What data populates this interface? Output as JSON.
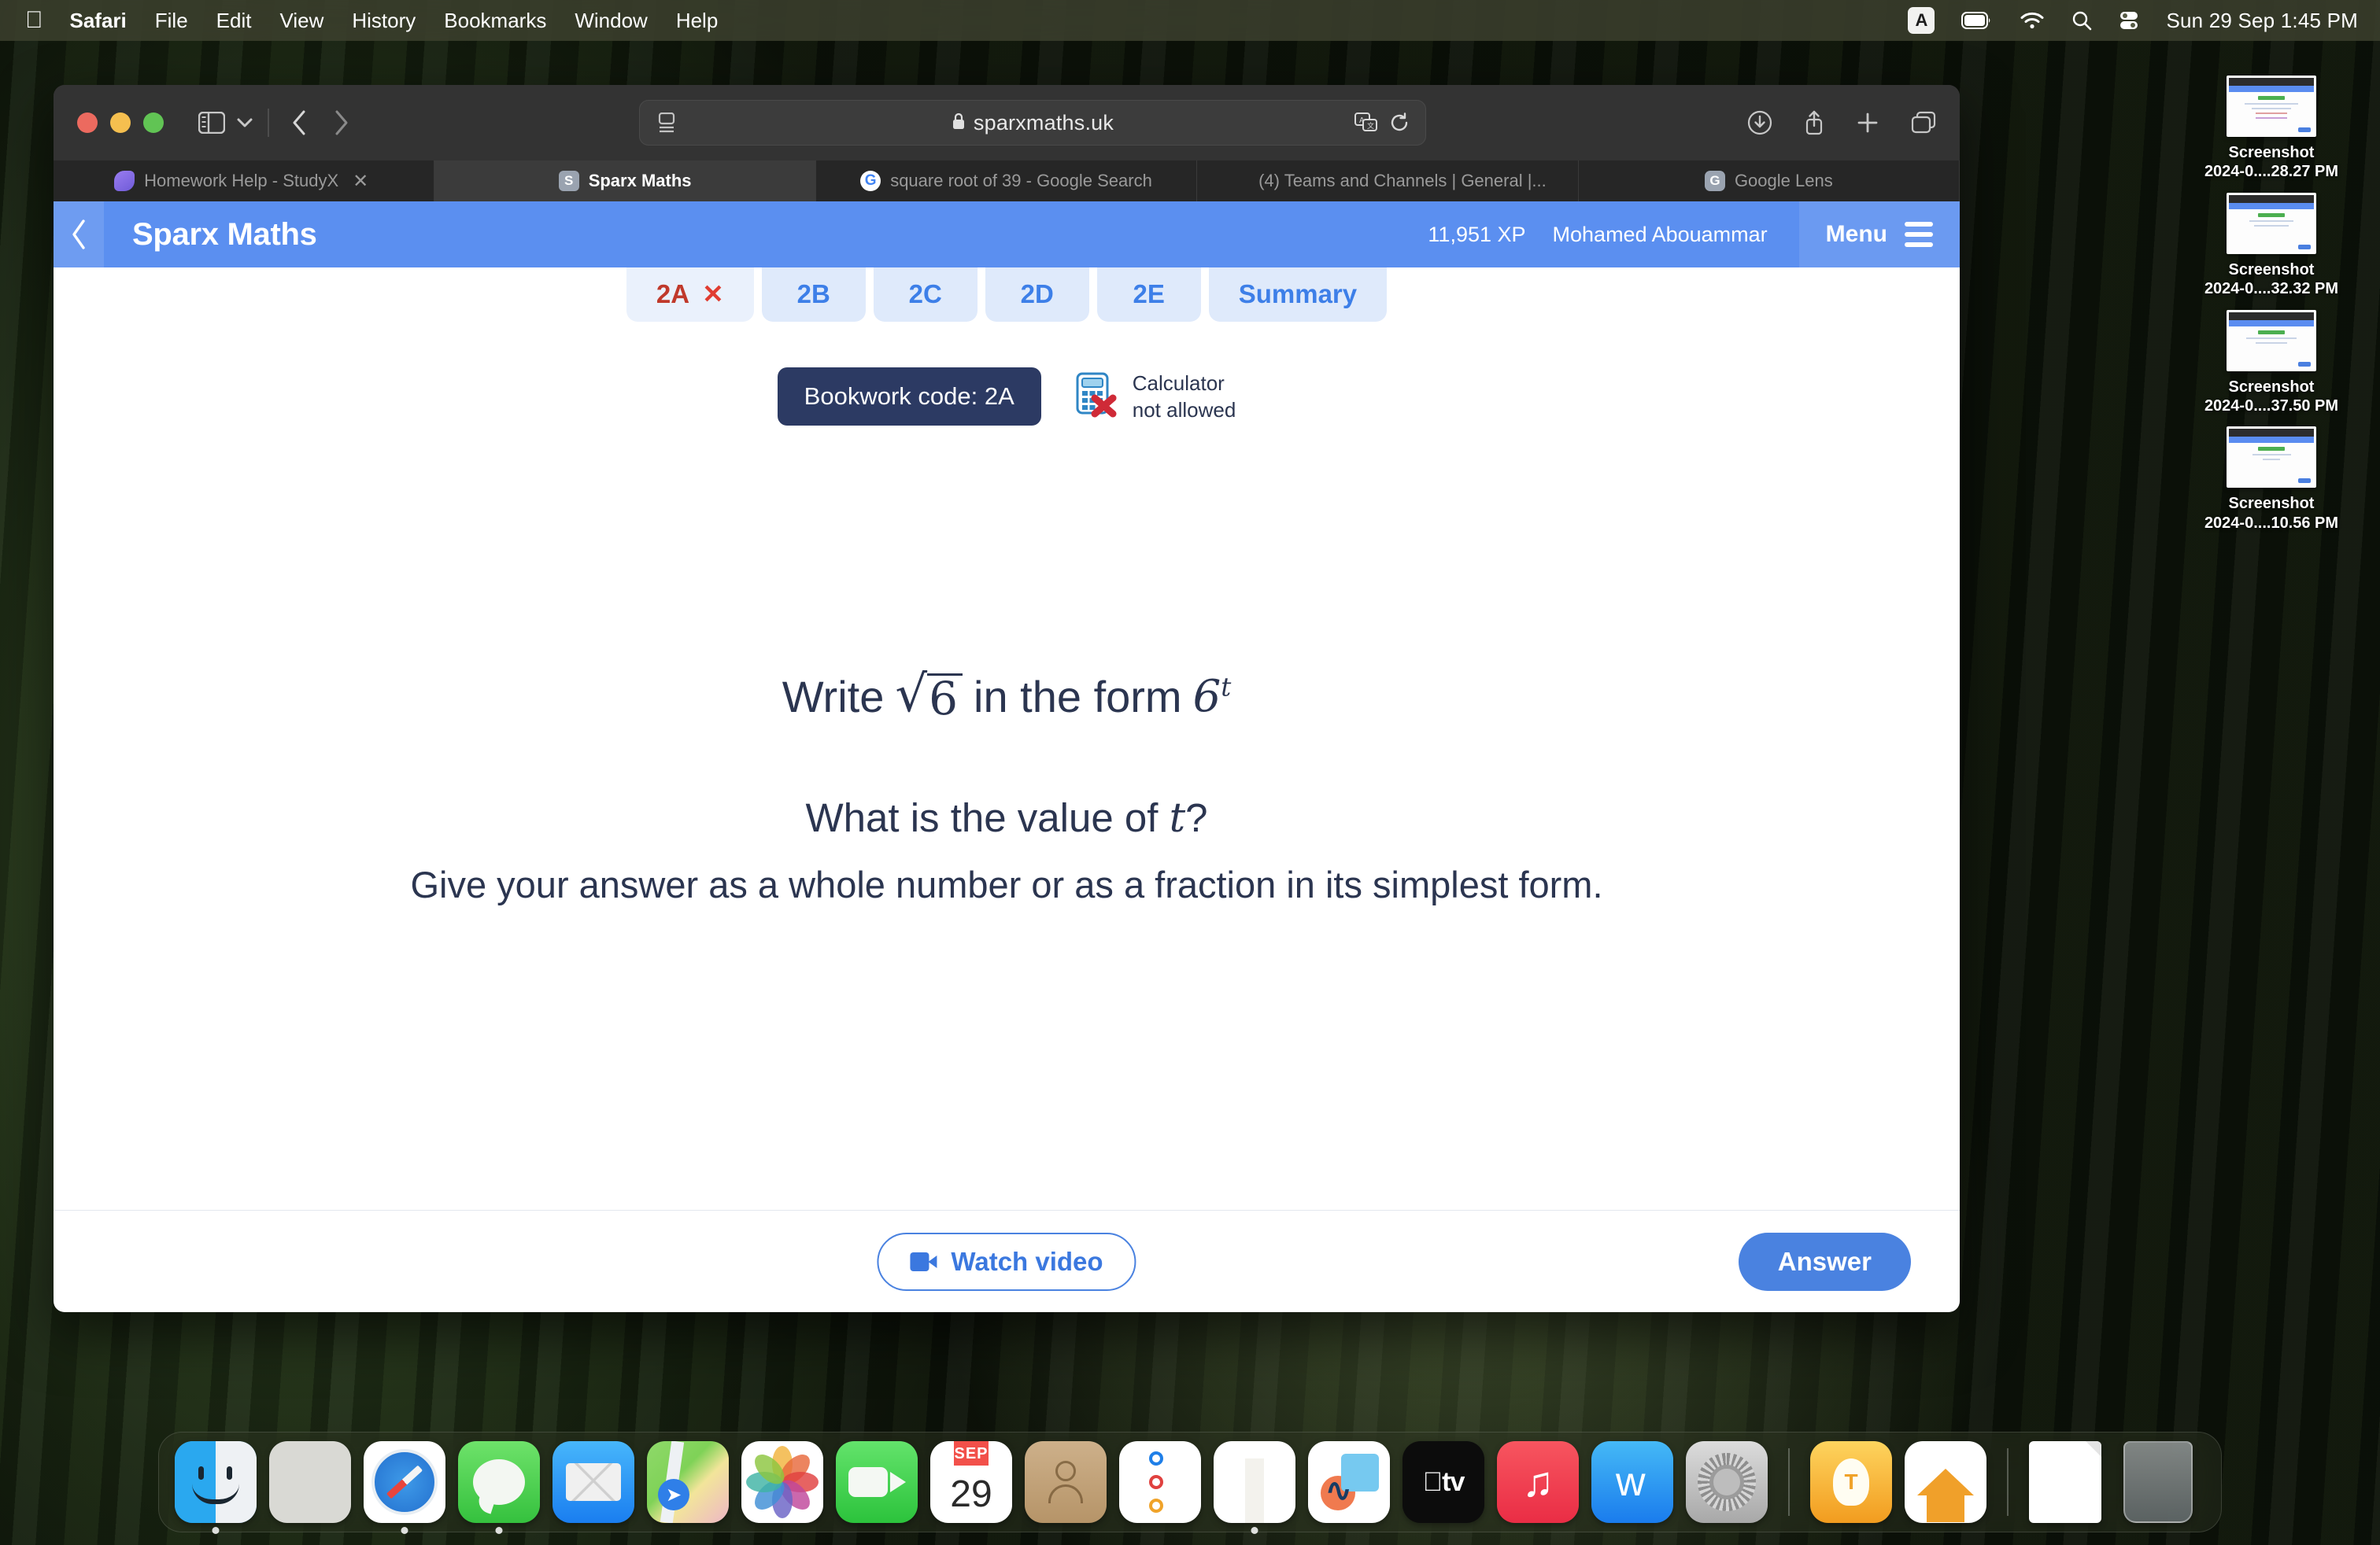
{
  "menubar": {
    "apple_icon": "apple-logo-icon",
    "items": [
      {
        "label": "Safari",
        "bold": true
      },
      {
        "label": "File",
        "bold": false
      },
      {
        "label": "Edit",
        "bold": false
      },
      {
        "label": "View",
        "bold": false
      },
      {
        "label": "History",
        "bold": false
      },
      {
        "label": "Bookmarks",
        "bold": false
      },
      {
        "label": "Window",
        "bold": false
      },
      {
        "label": "Help",
        "bold": false
      }
    ],
    "status": {
      "input_source": "A",
      "battery_icon": "battery-icon",
      "wifi_icon": "wifi-icon",
      "search_icon": "search-icon",
      "control_center_icon": "control-center-icon",
      "clock": "Sun 29 Sep  1:45 PM"
    }
  },
  "desktop_icons": [
    {
      "label_line1": "Screenshot",
      "label_line2": "2024-0....28.27 PM"
    },
    {
      "label_line1": "Screenshot",
      "label_line2": "2024-0....32.32 PM"
    },
    {
      "label_line1": "Screenshot",
      "label_line2": "2024-0....37.50 PM"
    },
    {
      "label_line1": "Screenshot",
      "label_line2": "2024-0....10.56 PM"
    }
  ],
  "browser": {
    "toolbar": {
      "sidebar_icon": "sidebar-toggle-icon",
      "chevron_icon": "chevron-down-icon",
      "back_icon": "back-arrow-icon",
      "forward_icon": "forward-arrow-icon",
      "reader_icon": "reader-view-icon",
      "lock_icon": "lock-icon",
      "url": "sparxmaths.uk",
      "translate_icon": "translate-icon",
      "reload_icon": "reload-icon",
      "downloads_icon": "downloads-icon",
      "share_icon": "share-icon",
      "newtab_icon": "new-tab-icon",
      "tabs_overview_icon": "tab-overview-icon"
    },
    "tabs": [
      {
        "label": "Homework Help - StudyX",
        "favicon": "studyx-icon",
        "active": false,
        "has_close": true
      },
      {
        "label": "Sparx Maths",
        "favicon": "sparx-icon",
        "active": true,
        "has_close": false
      },
      {
        "label": "square root of 39 - Google Search",
        "favicon": "google-icon",
        "active": false,
        "has_close": false
      },
      {
        "label": "(4) Teams and Channels | General |...",
        "favicon": "teams-icon",
        "active": false,
        "has_close": false
      },
      {
        "label": "Google Lens",
        "favicon": "google-lens-icon",
        "active": false,
        "has_close": false
      }
    ]
  },
  "sparx": {
    "header": {
      "back_icon": "back-chevron-icon",
      "title": "Sparx Maths",
      "xp": "11,951 XP",
      "user": "Mohamed Abouammar",
      "menu_label": "Menu",
      "menu_icon": "hamburger-menu-icon",
      "accent_color": "#5b8ff0"
    },
    "question_tabs": [
      {
        "label": "2A",
        "active": true,
        "mark": "✕"
      },
      {
        "label": "2B",
        "active": false,
        "mark": ""
      },
      {
        "label": "2C",
        "active": false,
        "mark": ""
      },
      {
        "label": "2D",
        "active": false,
        "mark": ""
      },
      {
        "label": "2E",
        "active": false,
        "mark": ""
      },
      {
        "label": "Summary",
        "active": false,
        "mark": ""
      }
    ],
    "meta": {
      "bookwork_code": "Bookwork code: 2A",
      "bookwork_bg": "#2c3a63",
      "calculator_icon": "calculator-not-allowed-icon",
      "calculator_line1": "Calculator",
      "calculator_line2": "not allowed"
    },
    "question": {
      "line1_prefix": "Write",
      "radical_symbol": "√",
      "radicand": "6",
      "line1_middle": "in the form",
      "base": "6",
      "exponent": "t",
      "line2": "What is the value of",
      "line2_var": "t",
      "line2_suffix": "?",
      "line3": "Give your answer as a whole number or as a fraction in its simplest form."
    },
    "footer": {
      "watch_video_label": "Watch video",
      "watch_video_icon": "video-camera-icon",
      "answer_label": "Answer",
      "answer_bg": "#4a82e0"
    }
  },
  "dock": {
    "items": [
      {
        "name": "Finder",
        "icon": "finder-icon",
        "running": true
      },
      {
        "name": "Launchpad",
        "icon": "launchpad-icon",
        "running": false
      },
      {
        "name": "Safari",
        "icon": "safari-icon",
        "running": true
      },
      {
        "name": "Messages",
        "icon": "messages-icon",
        "running": true
      },
      {
        "name": "Mail",
        "icon": "mail-icon",
        "running": false
      },
      {
        "name": "Maps",
        "icon": "maps-icon",
        "running": false
      },
      {
        "name": "Photos",
        "icon": "photos-icon",
        "running": false
      },
      {
        "name": "FaceTime",
        "icon": "facetime-icon",
        "running": false
      },
      {
        "name": "Calendar",
        "icon": "calendar-icon",
        "running": false,
        "month": "SEP",
        "day": "29"
      },
      {
        "name": "Contacts",
        "icon": "contacts-icon",
        "running": false
      },
      {
        "name": "Reminders",
        "icon": "reminders-icon",
        "running": false
      },
      {
        "name": "Notes",
        "icon": "notes-icon",
        "running": true
      },
      {
        "name": "Freeform",
        "icon": "freeform-icon",
        "running": false
      },
      {
        "name": "Apple TV",
        "icon": "apple-tv-icon",
        "running": false,
        "label": "tv"
      },
      {
        "name": "Music",
        "icon": "music-icon",
        "running": false
      },
      {
        "name": "App Store",
        "icon": "app-store-icon",
        "running": false
      },
      {
        "name": "System Settings",
        "icon": "system-settings-icon",
        "running": false
      },
      {
        "name": "Tips",
        "icon": "tips-icon",
        "running": false
      },
      {
        "name": "Home",
        "icon": "home-icon",
        "running": false
      },
      {
        "name": "Documents",
        "icon": "document-stack-icon",
        "running": false
      },
      {
        "name": "Trash",
        "icon": "trash-icon",
        "running": false
      }
    ]
  }
}
